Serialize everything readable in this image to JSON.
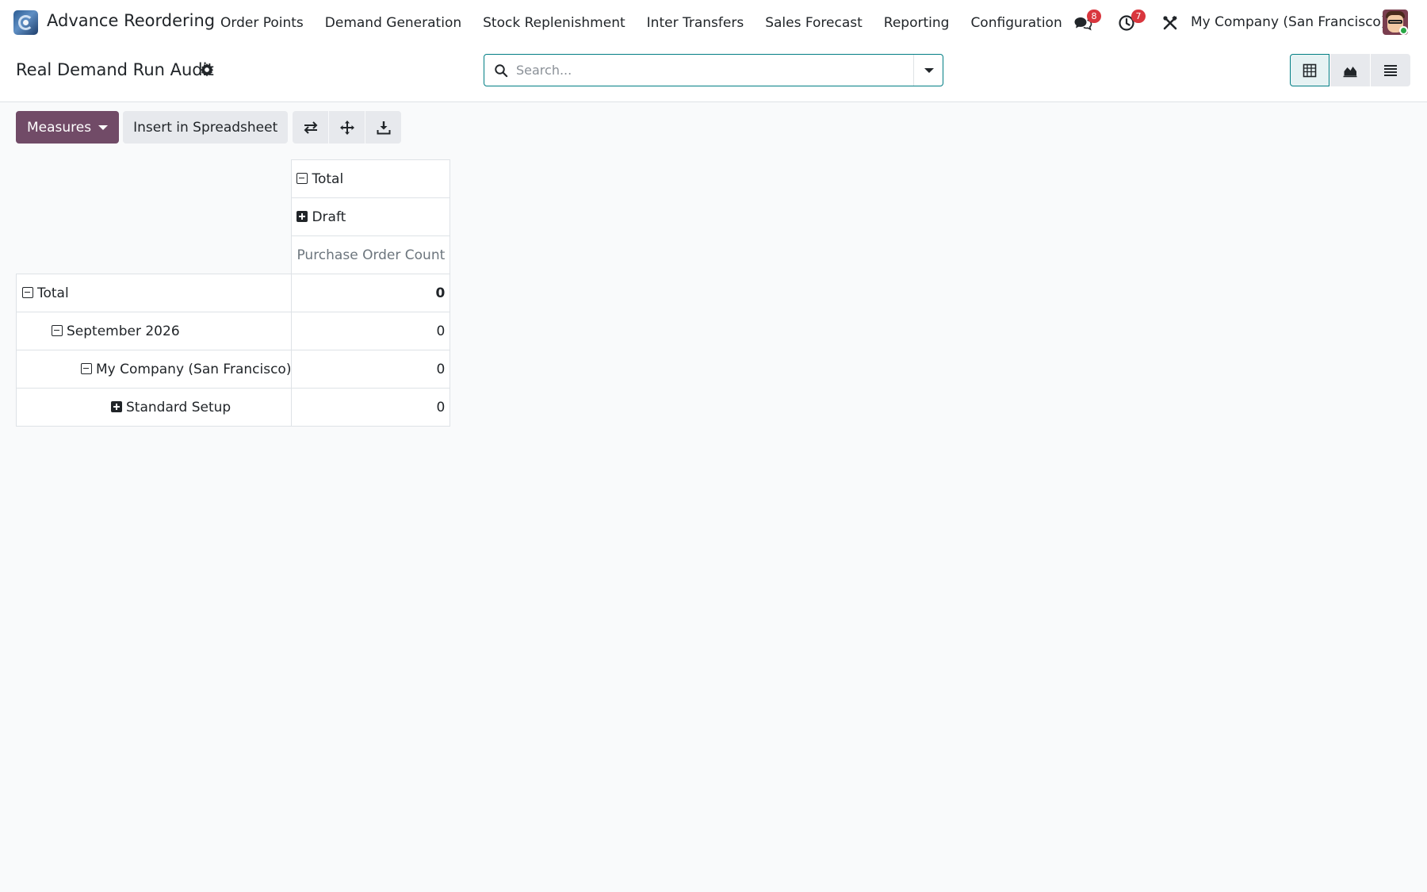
{
  "navbar": {
    "app_name": "Advance Reordering",
    "menu": [
      "Order Points",
      "Demand Generation",
      "Stock Replenishment",
      "Inter Transfers",
      "Sales Forecast",
      "Reporting",
      "Configuration"
    ],
    "messages_badge": "8",
    "activities_badge": "7",
    "company": "My Company (San Francisco)"
  },
  "control_panel": {
    "title": "Real Demand Run Audit",
    "search_placeholder": "Search...",
    "views": [
      "pivot-icon",
      "graph-icon",
      "list-icon"
    ],
    "active_view": "pivot"
  },
  "toolbar": {
    "measures_label": "Measures",
    "insert_label": "Insert in Spreadsheet",
    "icon_buttons": [
      "flip-axis-icon",
      "expand-all-icon",
      "download-icon"
    ]
  },
  "pivot": {
    "col_header_total": "Total",
    "col_header_group": "Draft",
    "measure": "Purchase Order Count",
    "rows": [
      {
        "label": "Total",
        "value": "0",
        "level": 0,
        "expanded": true
      },
      {
        "label": "September 2026",
        "value": "0",
        "level": 1,
        "expanded": true
      },
      {
        "label": "My Company (San Francisco)",
        "value": "0",
        "level": 2,
        "expanded": true
      },
      {
        "label": "Standard Setup",
        "value": "0",
        "level": 3,
        "expanded": false
      }
    ]
  },
  "colors": {
    "primary": "#714b67",
    "accent": "#017e84",
    "badge": "#d9363e"
  }
}
